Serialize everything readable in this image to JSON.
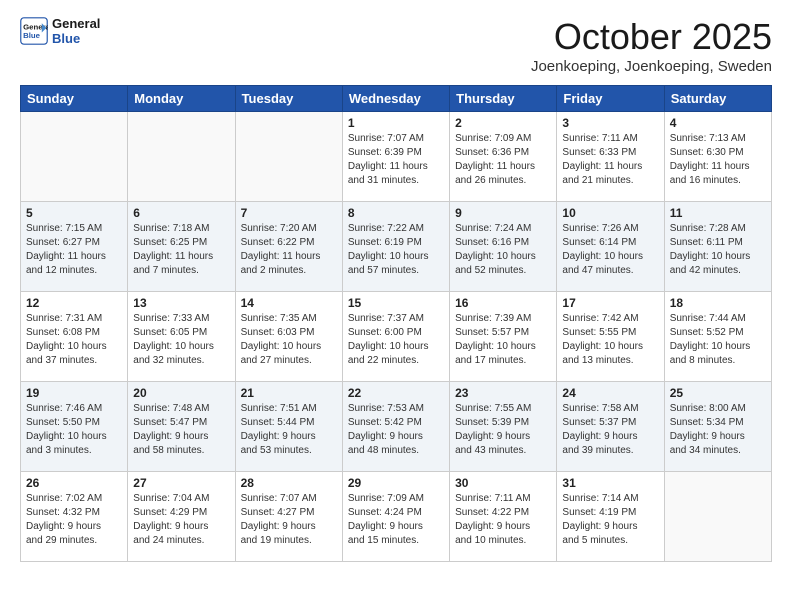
{
  "header": {
    "logo_line1": "General",
    "logo_line2": "Blue",
    "month": "October 2025",
    "location": "Joenkoeping, Joenkoeping, Sweden"
  },
  "weekdays": [
    "Sunday",
    "Monday",
    "Tuesday",
    "Wednesday",
    "Thursday",
    "Friday",
    "Saturday"
  ],
  "weeks": [
    [
      {
        "day": "",
        "info": ""
      },
      {
        "day": "",
        "info": ""
      },
      {
        "day": "",
        "info": ""
      },
      {
        "day": "1",
        "info": "Sunrise: 7:07 AM\nSunset: 6:39 PM\nDaylight: 11 hours\nand 31 minutes."
      },
      {
        "day": "2",
        "info": "Sunrise: 7:09 AM\nSunset: 6:36 PM\nDaylight: 11 hours\nand 26 minutes."
      },
      {
        "day": "3",
        "info": "Sunrise: 7:11 AM\nSunset: 6:33 PM\nDaylight: 11 hours\nand 21 minutes."
      },
      {
        "day": "4",
        "info": "Sunrise: 7:13 AM\nSunset: 6:30 PM\nDaylight: 11 hours\nand 16 minutes."
      }
    ],
    [
      {
        "day": "5",
        "info": "Sunrise: 7:15 AM\nSunset: 6:27 PM\nDaylight: 11 hours\nand 12 minutes."
      },
      {
        "day": "6",
        "info": "Sunrise: 7:18 AM\nSunset: 6:25 PM\nDaylight: 11 hours\nand 7 minutes."
      },
      {
        "day": "7",
        "info": "Sunrise: 7:20 AM\nSunset: 6:22 PM\nDaylight: 11 hours\nand 2 minutes."
      },
      {
        "day": "8",
        "info": "Sunrise: 7:22 AM\nSunset: 6:19 PM\nDaylight: 10 hours\nand 57 minutes."
      },
      {
        "day": "9",
        "info": "Sunrise: 7:24 AM\nSunset: 6:16 PM\nDaylight: 10 hours\nand 52 minutes."
      },
      {
        "day": "10",
        "info": "Sunrise: 7:26 AM\nSunset: 6:14 PM\nDaylight: 10 hours\nand 47 minutes."
      },
      {
        "day": "11",
        "info": "Sunrise: 7:28 AM\nSunset: 6:11 PM\nDaylight: 10 hours\nand 42 minutes."
      }
    ],
    [
      {
        "day": "12",
        "info": "Sunrise: 7:31 AM\nSunset: 6:08 PM\nDaylight: 10 hours\nand 37 minutes."
      },
      {
        "day": "13",
        "info": "Sunrise: 7:33 AM\nSunset: 6:05 PM\nDaylight: 10 hours\nand 32 minutes."
      },
      {
        "day": "14",
        "info": "Sunrise: 7:35 AM\nSunset: 6:03 PM\nDaylight: 10 hours\nand 27 minutes."
      },
      {
        "day": "15",
        "info": "Sunrise: 7:37 AM\nSunset: 6:00 PM\nDaylight: 10 hours\nand 22 minutes."
      },
      {
        "day": "16",
        "info": "Sunrise: 7:39 AM\nSunset: 5:57 PM\nDaylight: 10 hours\nand 17 minutes."
      },
      {
        "day": "17",
        "info": "Sunrise: 7:42 AM\nSunset: 5:55 PM\nDaylight: 10 hours\nand 13 minutes."
      },
      {
        "day": "18",
        "info": "Sunrise: 7:44 AM\nSunset: 5:52 PM\nDaylight: 10 hours\nand 8 minutes."
      }
    ],
    [
      {
        "day": "19",
        "info": "Sunrise: 7:46 AM\nSunset: 5:50 PM\nDaylight: 10 hours\nand 3 minutes."
      },
      {
        "day": "20",
        "info": "Sunrise: 7:48 AM\nSunset: 5:47 PM\nDaylight: 9 hours\nand 58 minutes."
      },
      {
        "day": "21",
        "info": "Sunrise: 7:51 AM\nSunset: 5:44 PM\nDaylight: 9 hours\nand 53 minutes."
      },
      {
        "day": "22",
        "info": "Sunrise: 7:53 AM\nSunset: 5:42 PM\nDaylight: 9 hours\nand 48 minutes."
      },
      {
        "day": "23",
        "info": "Sunrise: 7:55 AM\nSunset: 5:39 PM\nDaylight: 9 hours\nand 43 minutes."
      },
      {
        "day": "24",
        "info": "Sunrise: 7:58 AM\nSunset: 5:37 PM\nDaylight: 9 hours\nand 39 minutes."
      },
      {
        "day": "25",
        "info": "Sunrise: 8:00 AM\nSunset: 5:34 PM\nDaylight: 9 hours\nand 34 minutes."
      }
    ],
    [
      {
        "day": "26",
        "info": "Sunrise: 7:02 AM\nSunset: 4:32 PM\nDaylight: 9 hours\nand 29 minutes."
      },
      {
        "day": "27",
        "info": "Sunrise: 7:04 AM\nSunset: 4:29 PM\nDaylight: 9 hours\nand 24 minutes."
      },
      {
        "day": "28",
        "info": "Sunrise: 7:07 AM\nSunset: 4:27 PM\nDaylight: 9 hours\nand 19 minutes."
      },
      {
        "day": "29",
        "info": "Sunrise: 7:09 AM\nSunset: 4:24 PM\nDaylight: 9 hours\nand 15 minutes."
      },
      {
        "day": "30",
        "info": "Sunrise: 7:11 AM\nSunset: 4:22 PM\nDaylight: 9 hours\nand 10 minutes."
      },
      {
        "day": "31",
        "info": "Sunrise: 7:14 AM\nSunset: 4:19 PM\nDaylight: 9 hours\nand 5 minutes."
      },
      {
        "day": "",
        "info": ""
      }
    ]
  ]
}
